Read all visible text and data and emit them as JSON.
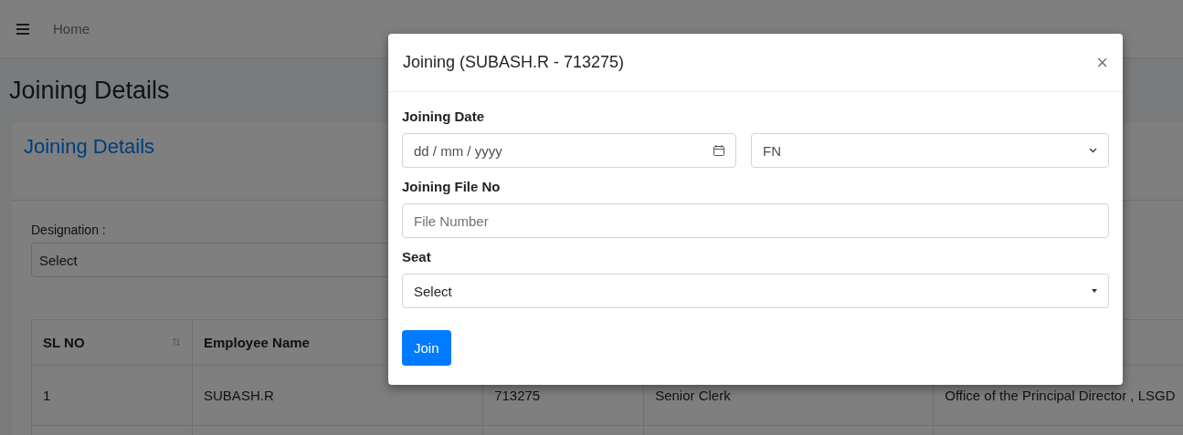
{
  "navbar": {
    "link": "Home"
  },
  "page_title": "Joining Details",
  "card": {
    "title": "Joining Details",
    "designation": {
      "label": "Designation :",
      "value": "Select"
    },
    "table": {
      "columns": [
        "SL NO",
        "Employee Name"
      ],
      "rows": [
        {
          "cells": [
            "1",
            "SUBASH.R",
            "713275",
            "Senior Clerk",
            "Office of the Principal Director , LSGD"
          ]
        }
      ]
    }
  },
  "modal": {
    "title": "Joining (SUBASH.R - 713275)",
    "close": "×",
    "fields": [
      {
        "kind": "date-session",
        "label": "Joining Date",
        "placeholder": "dd / mm / yyyy",
        "value": "FN"
      },
      {
        "kind": "text",
        "label": "Joining File No",
        "placeholder": "File Number"
      },
      {
        "kind": "select",
        "label": "Seat",
        "value": "Select"
      }
    ],
    "button": "Join"
  }
}
